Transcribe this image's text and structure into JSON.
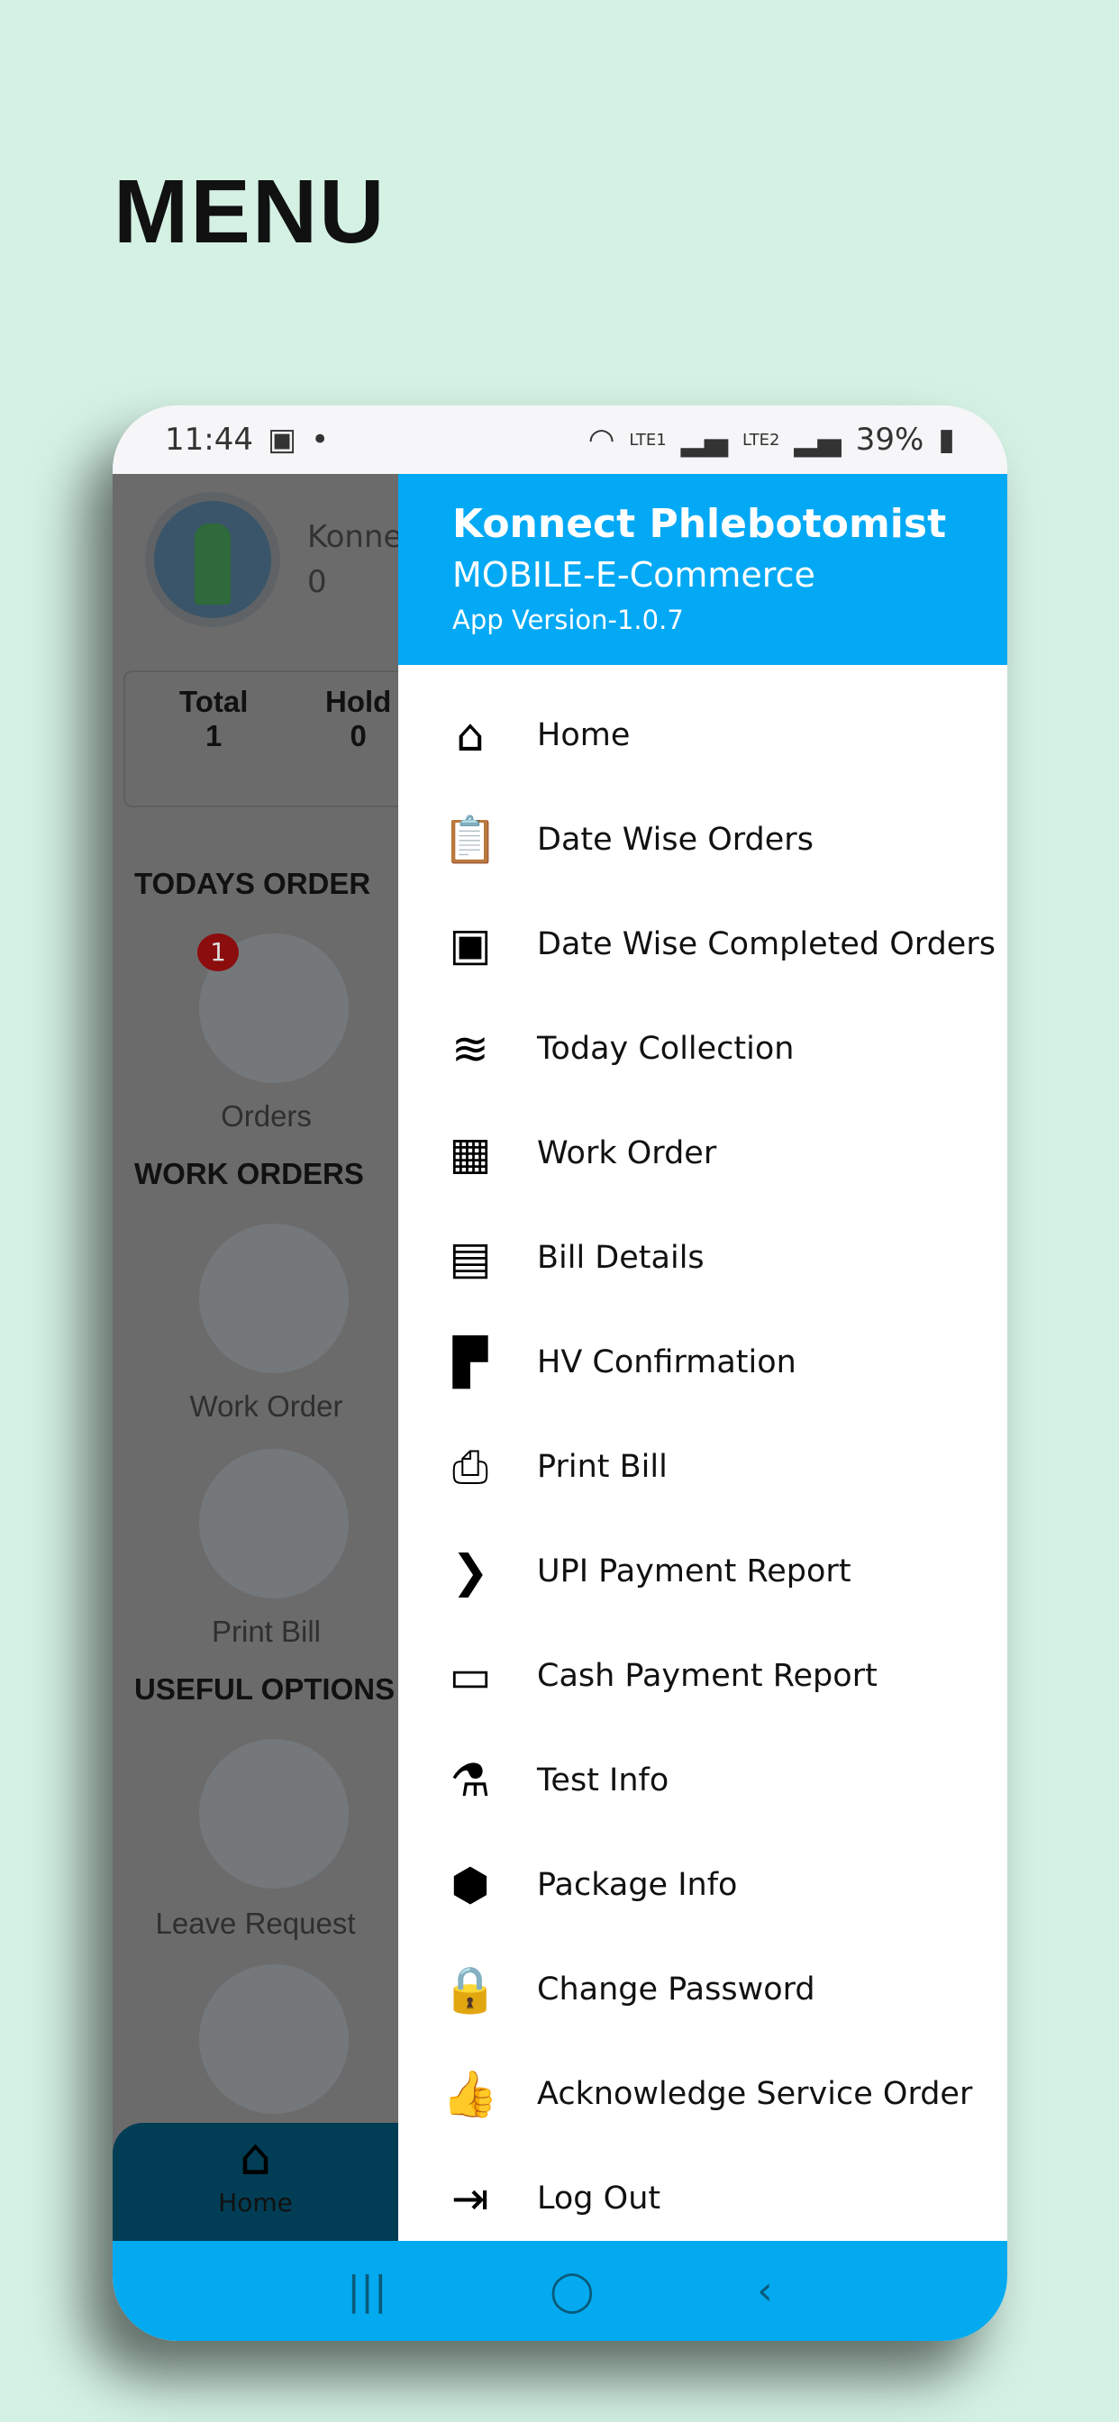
{
  "page_title": "MENU",
  "status_bar": {
    "time": "11:44",
    "battery": "39%",
    "sim1": "LTE1",
    "sim2": "LTE2"
  },
  "background_screen": {
    "user_name": "Konne",
    "user_value": "0",
    "stats": [
      {
        "label": "Total",
        "value": "1"
      },
      {
        "label": "Hold",
        "value": "0"
      }
    ],
    "sections": {
      "todays_order": "TODAYS ORDER",
      "work_orders": "WORK ORDERS",
      "useful_options": "USEFUL OPTIONS"
    },
    "tiles": {
      "orders": "Orders",
      "orders_badge": "1",
      "work_order": "Work Order",
      "print_bill": "Print Bill",
      "leave_request": "Leave Request"
    },
    "bottom_tab": "Home"
  },
  "drawer": {
    "app_name": "Konnect Phlebotomist",
    "subtitle": "MOBILE-E-Commerce",
    "version": "App Version-1.0.7",
    "accent": "#03a9f4",
    "items": [
      {
        "label": "Home",
        "icon": "home-icon"
      },
      {
        "label": "Date Wise Orders",
        "icon": "clipboard-check-icon"
      },
      {
        "label": "Date Wise Completed Orders",
        "icon": "box-check-icon"
      },
      {
        "label": "Today Collection",
        "icon": "coins-icon"
      },
      {
        "label": "Work Order",
        "icon": "boxes-icon"
      },
      {
        "label": "Bill Details",
        "icon": "receipt-icon"
      },
      {
        "label": "HV Confirmation",
        "icon": "document-icon"
      },
      {
        "label": "Print Bill",
        "icon": "printer-icon"
      },
      {
        "label": "UPI Payment Report",
        "icon": "upi-icon"
      },
      {
        "label": "Cash Payment Report",
        "icon": "cash-icon"
      },
      {
        "label": "Test Info",
        "icon": "test-tube-icon"
      },
      {
        "label": "Package Info",
        "icon": "package-icon"
      },
      {
        "label": "Change Password",
        "icon": "lock-icon"
      },
      {
        "label": "Acknowledge Service Order",
        "icon": "thumbs-up-icon"
      },
      {
        "label": "Log Out",
        "icon": "logout-icon"
      }
    ]
  }
}
